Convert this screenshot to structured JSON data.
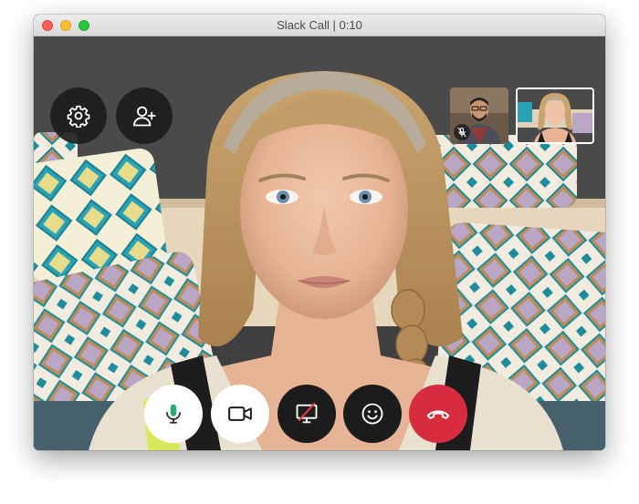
{
  "window": {
    "title": "Slack Call | 0:10",
    "traffic_lights": [
      "close",
      "minimize",
      "maximize"
    ]
  },
  "top_controls": [
    {
      "name": "settings-button",
      "icon": "gear-icon"
    },
    {
      "name": "add-person-button",
      "icon": "add-person-icon"
    }
  ],
  "participants": [
    {
      "name": "participant-thumbnail-man",
      "muted": true,
      "icon": "mic-muted-icon"
    },
    {
      "name": "participant-thumbnail-woman",
      "active": true
    }
  ],
  "call_controls": [
    {
      "name": "microphone-button",
      "icon": "microphone-icon",
      "color": "#ffffff"
    },
    {
      "name": "camera-button",
      "icon": "video-camera-icon",
      "color": "#ffffff"
    },
    {
      "name": "screen-share-button",
      "icon": "screen-share-off-icon",
      "color": "#1c1c1c"
    },
    {
      "name": "reactions-button",
      "icon": "smiley-icon",
      "color": "#1c1c1c"
    },
    {
      "name": "hang-up-button",
      "icon": "hang-up-icon",
      "color": "#d72b3f"
    }
  ],
  "colors": {
    "hang_up": "#d72b3f",
    "microphone_active": "#2bac76",
    "mute_slash": "#e8384f"
  }
}
